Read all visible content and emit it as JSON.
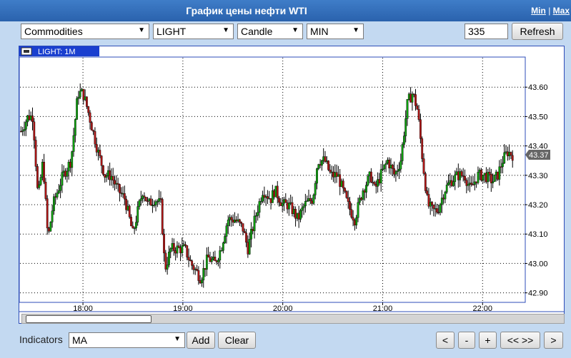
{
  "window": {
    "title": "График цены нефти WTI",
    "min_link": "Min",
    "separator": "|",
    "max_link": "Max"
  },
  "toolbar": {
    "market": "Commodities",
    "symbol": "LIGHT",
    "chart_style": "Candle",
    "interval": "MIN",
    "bar_count": "335",
    "refresh_label": "Refresh"
  },
  "footer": {
    "indicators_label": "Indicators",
    "indicator_value": "MA",
    "add_label": "Add",
    "clear_label": "Clear",
    "nav_prev": "<",
    "nav_zoom_out": "-",
    "nav_zoom_in": "+",
    "nav_expand": "<< >>",
    "nav_next": ">"
  },
  "colors": {
    "up_candle": "#0ca00c",
    "down_candle": "#b01515",
    "frame_border": "#2d4db8",
    "grid": "#000000",
    "price_tag_bg": "#666666"
  },
  "chart_data": {
    "type": "candlestick",
    "symbol_tag": "LIGHT: 1M",
    "last_price_label": "43.37",
    "y_ticks": [
      42.9,
      43.0,
      43.1,
      43.2,
      43.3,
      43.4,
      43.5,
      43.6
    ],
    "y_tick_labels": [
      "42.90",
      "43.00",
      "43.10",
      "43.20",
      "43.30",
      "43.40",
      "43.50",
      "43.60"
    ],
    "ylim": [
      42.87,
      43.7
    ],
    "x_ticks": [
      18,
      19,
      20,
      21,
      22
    ],
    "x_tick_labels": [
      "18:00",
      "19:00",
      "20:00",
      "21:00",
      "22:00"
    ],
    "xlim": [
      17.37,
      22.42
    ],
    "grid": true,
    "close_path": [
      [
        17.38,
        43.45
      ],
      [
        17.45,
        43.5
      ],
      [
        17.5,
        43.5
      ],
      [
        17.55,
        43.22
      ],
      [
        17.6,
        43.35
      ],
      [
        17.65,
        43.08
      ],
      [
        17.7,
        43.2
      ],
      [
        17.75,
        43.25
      ],
      [
        17.8,
        43.3
      ],
      [
        17.88,
        43.35
      ],
      [
        17.95,
        43.58
      ],
      [
        18.0,
        43.58
      ],
      [
        18.05,
        43.52
      ],
      [
        18.1,
        43.45
      ],
      [
        18.15,
        43.38
      ],
      [
        18.22,
        43.3
      ],
      [
        18.28,
        43.3
      ],
      [
        18.35,
        43.25
      ],
      [
        18.42,
        43.22
      ],
      [
        18.5,
        43.1
      ],
      [
        18.55,
        43.18
      ],
      [
        18.6,
        43.25
      ],
      [
        18.65,
        43.2
      ],
      [
        18.72,
        43.22
      ],
      [
        18.78,
        43.2
      ],
      [
        18.82,
        42.98
      ],
      [
        18.88,
        43.05
      ],
      [
        18.95,
        43.05
      ],
      [
        19.02,
        43.05
      ],
      [
        19.08,
        43.0
      ],
      [
        19.12,
        42.98
      ],
      [
        19.18,
        42.95
      ],
      [
        19.25,
        43.02
      ],
      [
        19.32,
        43.0
      ],
      [
        19.38,
        43.05
      ],
      [
        19.45,
        43.15
      ],
      [
        19.52,
        43.15
      ],
      [
        19.6,
        43.12
      ],
      [
        19.65,
        43.05
      ],
      [
        19.72,
        43.15
      ],
      [
        19.8,
        43.25
      ],
      [
        19.88,
        43.22
      ],
      [
        19.92,
        43.25
      ],
      [
        20.0,
        43.2
      ],
      [
        20.05,
        43.2
      ],
      [
        20.1,
        43.18
      ],
      [
        20.15,
        43.15
      ],
      [
        20.22,
        43.2
      ],
      [
        20.3,
        43.22
      ],
      [
        20.35,
        43.35
      ],
      [
        20.42,
        43.35
      ],
      [
        20.48,
        43.3
      ],
      [
        20.55,
        43.3
      ],
      [
        20.6,
        43.25
      ],
      [
        20.65,
        43.2
      ],
      [
        20.72,
        43.15
      ],
      [
        20.8,
        43.25
      ],
      [
        20.88,
        43.3
      ],
      [
        20.92,
        43.25
      ],
      [
        20.98,
        43.3
      ],
      [
        21.05,
        43.35
      ],
      [
        21.12,
        43.3
      ],
      [
        21.18,
        43.35
      ],
      [
        21.25,
        43.55
      ],
      [
        21.3,
        43.58
      ],
      [
        21.35,
        43.52
      ],
      [
        21.4,
        43.35
      ],
      [
        21.45,
        43.2
      ],
      [
        21.5,
        43.18
      ],
      [
        21.55,
        43.18
      ],
      [
        21.62,
        43.25
      ],
      [
        21.68,
        43.28
      ],
      [
        21.75,
        43.3
      ],
      [
        21.82,
        43.3
      ],
      [
        21.88,
        43.25
      ],
      [
        21.95,
        43.3
      ],
      [
        22.02,
        43.3
      ],
      [
        22.1,
        43.28
      ],
      [
        22.15,
        43.3
      ],
      [
        22.2,
        43.35
      ],
      [
        22.25,
        43.38
      ],
      [
        22.3,
        43.37
      ]
    ]
  }
}
